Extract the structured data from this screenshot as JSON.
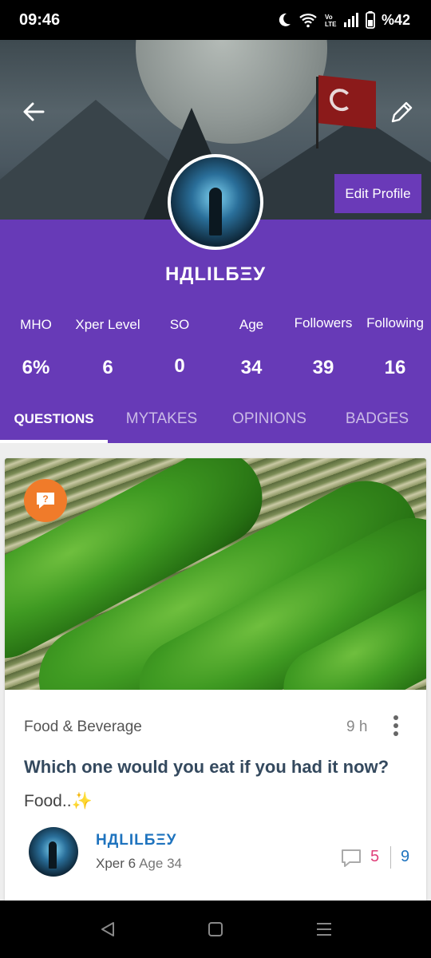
{
  "status_bar": {
    "time": "09:46",
    "battery": "%42",
    "icons": [
      "moon-icon",
      "wifi-icon",
      "volte-icon",
      "signal-icon",
      "battery-icon"
    ]
  },
  "header": {
    "icons": {
      "back": "back-arrow-icon",
      "edit": "pencil-icon"
    },
    "edit_profile_label": "Edit Profile"
  },
  "profile": {
    "username": "НДLІLБΞУ",
    "stats": [
      {
        "label": "MHO",
        "value": "6%"
      },
      {
        "label": "Xper Level",
        "value": "6"
      },
      {
        "label": "SO",
        "value": "0"
      },
      {
        "label": "Age",
        "value": "34"
      },
      {
        "label": "Followers",
        "value": "39"
      },
      {
        "label": "Following",
        "value": "16"
      }
    ]
  },
  "tabs": [
    {
      "label": "QUESTIONS",
      "active": true
    },
    {
      "label": "MYTAKES",
      "active": false
    },
    {
      "label": "OPINIONS",
      "active": false
    },
    {
      "label": "BADGES",
      "active": false
    }
  ],
  "post": {
    "category": "Food & Beverage",
    "time_ago": "9 h",
    "title": "Which one would you eat if you had it now?",
    "body": "Food..✨",
    "author": {
      "name": "НДLІLБΞУ",
      "xper": "Xper 6",
      "age": "Age 34"
    },
    "comment_count": "5",
    "opinion_count": "9",
    "badge_icon": "question-badge-icon"
  },
  "colors": {
    "brand_purple": "#673ab7",
    "badge_orange": "#f07b2a",
    "link_blue": "#1e73be",
    "comment_pink": "#e0407a"
  }
}
